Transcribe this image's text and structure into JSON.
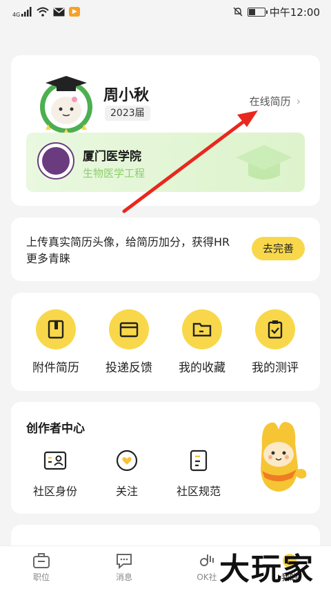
{
  "status_bar": {
    "network": "4G",
    "app_badge": "▶",
    "time": "中午12:00"
  },
  "profile": {
    "name": "周小秋",
    "grade": "2023届",
    "resume_link": "在线简历",
    "school": "厦门医学院",
    "major": "生物医学工程"
  },
  "upload": {
    "text": "上传真实简历头像，给简历加分，获得HR更多青睐",
    "button": "去完善"
  },
  "tools": [
    {
      "label": "附件简历",
      "icon": "attachment-resume-icon"
    },
    {
      "label": "投递反馈",
      "icon": "delivery-feedback-icon"
    },
    {
      "label": "我的收藏",
      "icon": "folder-icon"
    },
    {
      "label": "我的测评",
      "icon": "clipboard-check-icon"
    }
  ],
  "creator": {
    "title": "创作者中心",
    "items": [
      {
        "label": "社区身份",
        "icon": "id-card-icon"
      },
      {
        "label": "关注",
        "icon": "heart-icon"
      },
      {
        "label": "社区规范",
        "icon": "document-icon"
      }
    ]
  },
  "bottom_nav": [
    {
      "label": "职位",
      "icon": "briefcase-icon"
    },
    {
      "label": "消息",
      "icon": "chat-icon"
    },
    {
      "label": "OK社",
      "icon": "ok-hand-icon"
    },
    {
      "label": "我的",
      "icon": "profile-icon",
      "active": true
    }
  ],
  "watermark": "大玩家",
  "colors": {
    "accent_yellow": "#f8d84a",
    "annotation_red": "#e8281e",
    "school_green": "#8ccf6a"
  }
}
